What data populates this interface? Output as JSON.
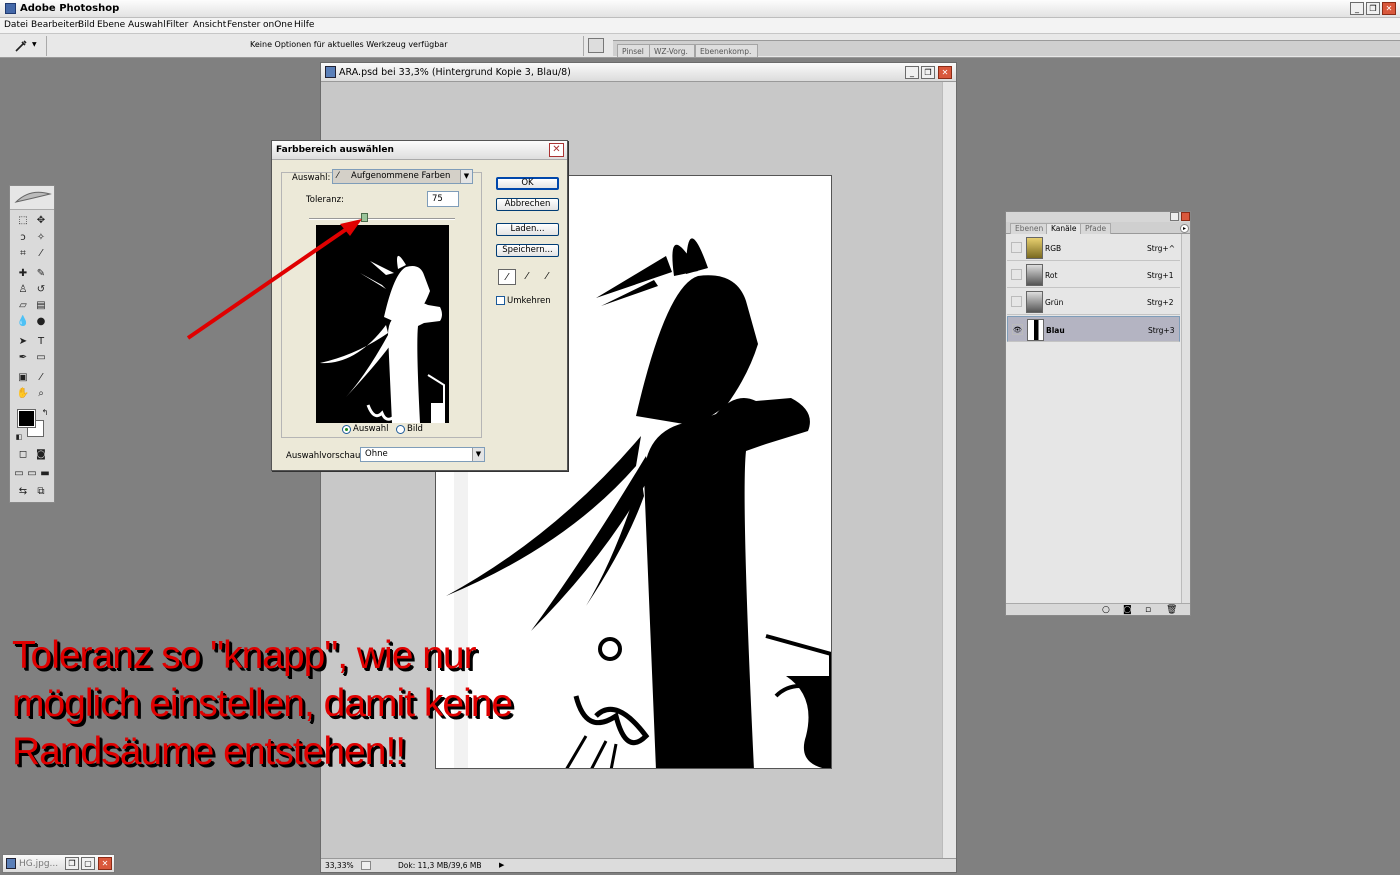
{
  "app": {
    "title": "Adobe Photoshop"
  },
  "menu": [
    "Datei",
    "Bearbeiten",
    "Bild",
    "Ebene",
    "Auswahl",
    "Filter",
    "Ansicht",
    "Fenster",
    "onOne",
    "Hilfe"
  ],
  "options_bar": {
    "message": "Keine Optionen für aktuelles Werkzeug verfügbar"
  },
  "palette_well": {
    "tabs": [
      "Pinsel",
      "WZ-Vorg.",
      "Ebenenkomp."
    ]
  },
  "document": {
    "title": "ARA.psd bei 33,3% (Hintergrund Kopie 3, Blau/8)",
    "zoom": "33,33%",
    "doc_info": "Dok: 11,3 MB/39,6 MB"
  },
  "dialog": {
    "title": "Farbbereich auswählen",
    "select_label": "Auswahl:",
    "select_value": "Aufgenommene Farben",
    "tolerance_label": "Toleranz:",
    "tolerance_value": "75",
    "tolerance_fraction": 0.375,
    "buttons": {
      "ok": "OK",
      "cancel": "Abbrechen",
      "load": "Laden...",
      "save": "Speichern..."
    },
    "invert_label": "Umkehren",
    "invert_checked": false,
    "radio_selection": "Auswahl",
    "radio_image": "Bild",
    "radio_selected": "Auswahl",
    "preview_label": "Auswahlvorschau:",
    "preview_value": "Ohne"
  },
  "channels_panel": {
    "tabs": [
      "Ebenen",
      "Kanäle",
      "Pfade"
    ],
    "active_tab": "Kanäle",
    "rows": [
      {
        "name": "RGB",
        "shortcut": "Strg+^",
        "visible": false,
        "selected": false
      },
      {
        "name": "Rot",
        "shortcut": "Strg+1",
        "visible": false,
        "selected": false
      },
      {
        "name": "Grün",
        "shortcut": "Strg+2",
        "visible": false,
        "selected": false
      },
      {
        "name": "Blau",
        "shortcut": "Strg+3",
        "visible": true,
        "selected": true
      }
    ]
  },
  "minimized_doc": {
    "title": "HG.jpg..."
  },
  "annotation": {
    "line1": "Toleranz so \"knapp\", wie nur",
    "line2": "möglich einstellen, damit keine",
    "line3": "Randsäume entstehen!!",
    "color": "#e00000"
  },
  "colors": {
    "foreground": "#000000",
    "background": "#ffffff",
    "arrow": "#e00000"
  }
}
